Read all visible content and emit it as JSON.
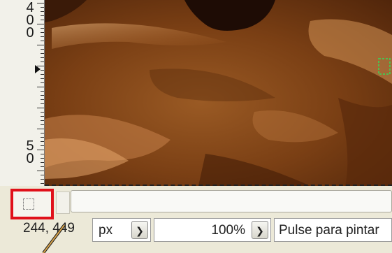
{
  "ruler": {
    "top_digits": [
      "4",
      "0",
      "0"
    ],
    "bottom_digits": [
      "5",
      "0"
    ]
  },
  "status": {
    "coordinates": "244, 449",
    "unit": "px",
    "zoom": "100%",
    "hint": "Pulse para pintar"
  },
  "colors": {
    "highlight": "#e0101a",
    "canvas_base": "#7a3f14"
  },
  "icons": {
    "navigate": "navigate-icon",
    "dropdown": "chevron-down-icon"
  }
}
